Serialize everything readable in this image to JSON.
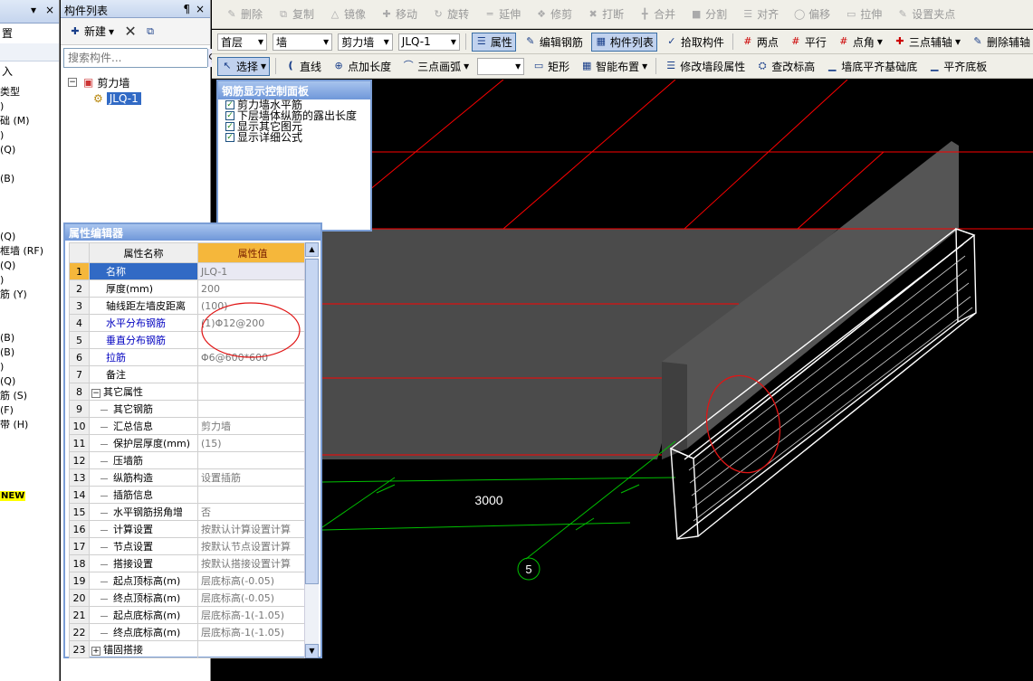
{
  "left_panel": {
    "pin": "▼ ¶",
    "close": "×",
    "rows": [
      "置",
      "入"
    ],
    "list": [
      "类型",
      ")",
      "础 (M)",
      ")",
      "(Q)",
      "",
      "(B)",
      "",
      "",
      "",
      "(Q)",
      "框墙 (RF)",
      "(Q)",
      ")",
      "筋 (Y)",
      "",
      "",
      "(B)",
      "(B)",
      ")",
      "(Q)",
      "筋 (S)",
      "(F)",
      "带 (H)"
    ],
    "new_badge": "NEW"
  },
  "component_list": {
    "title": "构件列表",
    "pin": "¶",
    "close": "×",
    "new_label": "新建",
    "search_placeholder": "搜索构件...",
    "tree_root": "剪力墙",
    "tree_child": "JLQ-1"
  },
  "toolbar1": [
    "删除",
    "复制",
    "镜像",
    "移动",
    "旋转",
    "延伸",
    "修剪",
    "打断",
    "合并",
    "分割",
    "对齐",
    "偏移",
    "拉伸",
    "设置夹点"
  ],
  "toolbar2": {
    "floor": "首层",
    "type": "墙",
    "subtype": "剪力墙",
    "component": "JLQ-1",
    "buttons": [
      "属性",
      "编辑钢筋",
      "构件列表",
      "拾取构件",
      "两点",
      "平行",
      "点角",
      "三点辅轴",
      "删除辅轴"
    ]
  },
  "toolbar3": {
    "buttons": [
      "选择",
      "直线",
      "点加长度",
      "三点画弧",
      "矩形",
      "智能布置",
      "修改墙段属性",
      "查改标高",
      "墙底平齐基础底",
      "平齐底板"
    ]
  },
  "control_panel": {
    "title": "钢筋显示控制面板",
    "items": [
      "剪力墙水平筋",
      "下层墙体纵筋的露出长度",
      "显示其它图元",
      "显示详细公式"
    ]
  },
  "property_editor": {
    "title": "属性编辑器",
    "col_name": "属性名称",
    "col_value": "属性值",
    "rows": [
      {
        "n": "1",
        "name": "名称",
        "value": "JLQ-1"
      },
      {
        "n": "2",
        "name": "厚度(mm)",
        "value": "200"
      },
      {
        "n": "3",
        "name": "轴线距左墙皮距离",
        "value": "(100)"
      },
      {
        "n": "4",
        "name": "水平分布钢筋",
        "value": "(1)Φ12@200"
      },
      {
        "n": "5",
        "name": "垂直分布钢筋",
        "value": ""
      },
      {
        "n": "6",
        "name": "拉筋",
        "value": "Φ6@600*600"
      },
      {
        "n": "7",
        "name": "备注",
        "value": ""
      },
      {
        "n": "8",
        "name": "其它属性",
        "value": ""
      },
      {
        "n": "9",
        "name": "其它钢筋",
        "value": ""
      },
      {
        "n": "10",
        "name": "汇总信息",
        "value": "剪力墙"
      },
      {
        "n": "11",
        "name": "保护层厚度(mm)",
        "value": "(15)"
      },
      {
        "n": "12",
        "name": "压墙筋",
        "value": ""
      },
      {
        "n": "13",
        "name": "纵筋构造",
        "value": "设置插筋"
      },
      {
        "n": "14",
        "name": "插筋信息",
        "value": ""
      },
      {
        "n": "15",
        "name": "水平钢筋拐角增",
        "value": "否"
      },
      {
        "n": "16",
        "name": "计算设置",
        "value": "按默认计算设置计算"
      },
      {
        "n": "17",
        "name": "节点设置",
        "value": "按默认节点设置计算"
      },
      {
        "n": "18",
        "name": "搭接设置",
        "value": "按默认搭接设置计算"
      },
      {
        "n": "19",
        "name": "起点顶标高(m)",
        "value": "层底标高(-0.05)"
      },
      {
        "n": "20",
        "name": "终点顶标高(m)",
        "value": "层底标高(-0.05)"
      },
      {
        "n": "21",
        "name": "起点底标高(m)",
        "value": "层底标高-1(-1.05)"
      },
      {
        "n": "22",
        "name": "终点底标高(m)",
        "value": "层底标高-1(-1.05)"
      },
      {
        "n": "23",
        "name": "锚固搭接",
        "value": ""
      }
    ]
  },
  "viewport": {
    "dimension_label": "3000",
    "axis_label": "5"
  },
  "colors": {
    "grid_red": "#ff0000",
    "dim_green": "#00c000",
    "wall_gray": "#595959",
    "slab_gray": "#4d4d4d",
    "title_blue": "#6f97d9",
    "header_orange": "#f5b73b"
  }
}
